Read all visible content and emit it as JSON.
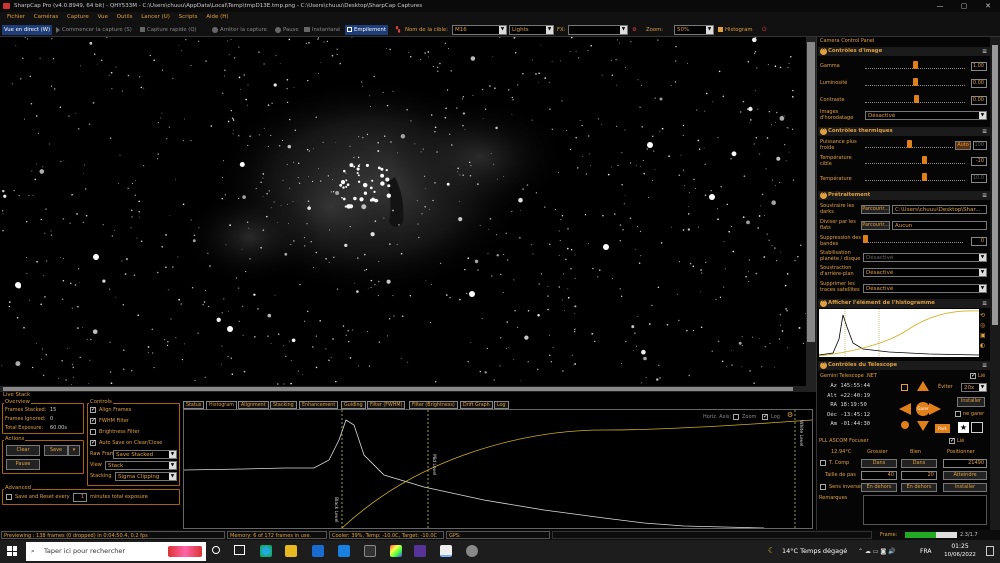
{
  "titlebar": {
    "title": "SharpCap Pro (v4.0.8949, 64 bit) - QHY533M - C:\\Users\\chuuu\\AppData\\Local\\Temp\\tmpD13E.tmp.png - C:\\Users\\chuuu\\Desktop\\SharpCap Captures",
    "minimize": "—",
    "maximize": "▢",
    "close": "✕"
  },
  "menu": [
    "Fichier",
    "Caméras",
    "Capture",
    "Vue",
    "Outils",
    "Lancer (U)",
    "Scripts",
    "Aide (H)"
  ],
  "toolbar": {
    "live_view": "Vue en direct (W)",
    "start_capture": "Commencer la capture (S)",
    "quick_capture": "Capture rapide (Q)",
    "stop_capture": "Arrêter la capture",
    "pause": "Pause",
    "snapshot": "Instantané",
    "stack": "Empilement",
    "target_label": "Nom de la cible:",
    "target_value": "M16",
    "frame_type": "Lights",
    "fx_label": "FX:",
    "fx_value": "",
    "zoom_label": "Zoom:",
    "zoom_value": "50%",
    "histogram": "Histogram"
  },
  "panel": {
    "title": "Camera Control Panel",
    "image_controls": {
      "title": "Contrôles d'image",
      "gamma_label": "Gamma",
      "gamma_value": "1.00",
      "gamma_level": 0.5,
      "brightness_label": "Luminosité",
      "brightness_value": "0.00",
      "brightness_level": 0.5,
      "contrast_label": "Contraste",
      "contrast_value": "0.00",
      "contrast_level": 0.52,
      "timestamp_label": "Images d'horodatage",
      "timestamp_value": "Désactivé"
    },
    "thermal": {
      "title": "Contrôles thermiques",
      "cooler_label": "Puissance plus froide",
      "cooler_auto": "Auto",
      "cooler_value": "100",
      "cooler_level": 0.5,
      "target_temp_label": "Température cible",
      "target_temp_value": "-10",
      "target_temp_level": 0.6,
      "temp_label": "Température",
      "temp_value": "10.0",
      "temp_level": 0.6
    },
    "preprocessing": {
      "title": "Prétraitement",
      "subtract_darks_label": "Soustraire les darks",
      "browse": "Parcourir...",
      "darks_path": "C:\\Users\\chuuu\\Desktop\\Shar...",
      "divide_flats_label": "Diviser par les flats",
      "flats_value": "Aucun",
      "banding_label": "Suppression des bandes",
      "banding_value": "0",
      "banding_level": 0.0,
      "stabilization_label": "Stabilisation planète / disque",
      "stabilization_value": "Désactivé",
      "background_label": "Soustraction d'arrière-plan",
      "background_value": "Désactivé",
      "satellite_label": "Supprimer les traces satellites",
      "satellite_value": "Désactivé"
    },
    "histogram_section": {
      "title": "Afficher l'élément de l'histogramme"
    },
    "telescope": {
      "title": "Contrôles du Télescope",
      "mount": "Gemini Telescope .NET",
      "linked": "Lié",
      "avoid_label": "Éviter",
      "avoid_value": "20x",
      "az_label": "Az",
      "az": "145:55:44",
      "alt_label": "Alt",
      "alt": "+22:40:19",
      "ra_label": "RA",
      "ra": "18:19:50",
      "dec_label": "Déc",
      "dec": "-13:45:12",
      "am_label": "Am",
      "am": "-01:44:30",
      "install": "Installer",
      "park": "Garer",
      "park2": "Park",
      "dont_park": "ne garer",
      "focuser": "PLL ASCOM Focuser",
      "focuser_linked": "Lié",
      "focus_temp": "12.94°C",
      "coarse": "Grossier",
      "fine": "Bien",
      "position": "Positionner",
      "tcomp": "T. Comp",
      "in1": "Dans",
      "in2": "Dans",
      "pos_value": "21490",
      "step_label": "Taille de pas",
      "step1": "40",
      "step2": "20",
      "reach": "Atteindre",
      "reverse": "Sens inverse",
      "out1": "En dehors",
      "out2": "En dehors",
      "install2": "Installer",
      "notes": "Remarques"
    }
  },
  "live_stack": {
    "title": "Live Stack",
    "overview_title": "Overview",
    "frames_stacked_label": "Frames Stacked:",
    "frames_stacked": "15",
    "frames_ignored_label": "Frames Ignored:",
    "frames_ignored": "0",
    "total_exposure_label": "Total Exposure:",
    "total_exposure": "60.00s",
    "actions_title": "Actions",
    "clear": "Clear",
    "save": "Save",
    "pause": "Pause",
    "controls_title": "Controls",
    "align_frames": "Align Frames",
    "fwhm_filter": "FWHM Filter",
    "brightness_filter": "Brightness Filter",
    "autosave": "Auto Save on Clear/Close",
    "raw_frames_label": "Raw Frames",
    "raw_frames_value": "Save Stacked",
    "view_label": "View",
    "view_value": "Stack",
    "stacking_label": "Stacking",
    "stacking_value": "Sigma Clipping",
    "advanced_title": "Advanced",
    "save_reset_label": "Save and Reset every",
    "save_reset_value": "1",
    "save_reset_suffix": "minutes total exposure"
  },
  "tabs": [
    "Status",
    "Histogram",
    "Alignment",
    "Stacking",
    "Enhancement",
    "Guiding",
    "Filter (FWHM)",
    "Filter (Brightness)",
    "Drift Graph",
    "Log"
  ],
  "hist_panel": {
    "horiz_axis": "Horiz. Axis:",
    "zoom": "Zoom",
    "log": "Log",
    "black_level": "Black Level",
    "mid_level": "Mid Level",
    "white_level": "White Level"
  },
  "status": {
    "preview": "Previewing : 138 frames (0 dropped) in 0:04:50.4, 0.2 fps",
    "memory": "Memory: 6 of 172 frames in use.",
    "cooler": "Cooler: 39%, Temp: -10.0C, Target: -10.0C",
    "gps": "GPS:",
    "frame_label": "Frame:",
    "frame_progress": 0.6,
    "frame_value": "2.3/1.7"
  },
  "taskbar": {
    "search": "Taper ici pour rechercher",
    "weather": "14°C  Temps dégagé",
    "lang": "FRA",
    "time": "01:25",
    "date": "10/06/2022"
  },
  "colors": {
    "accent": "#e0a040",
    "knob": "#e0801a",
    "active_tab": "#1e3d78"
  }
}
